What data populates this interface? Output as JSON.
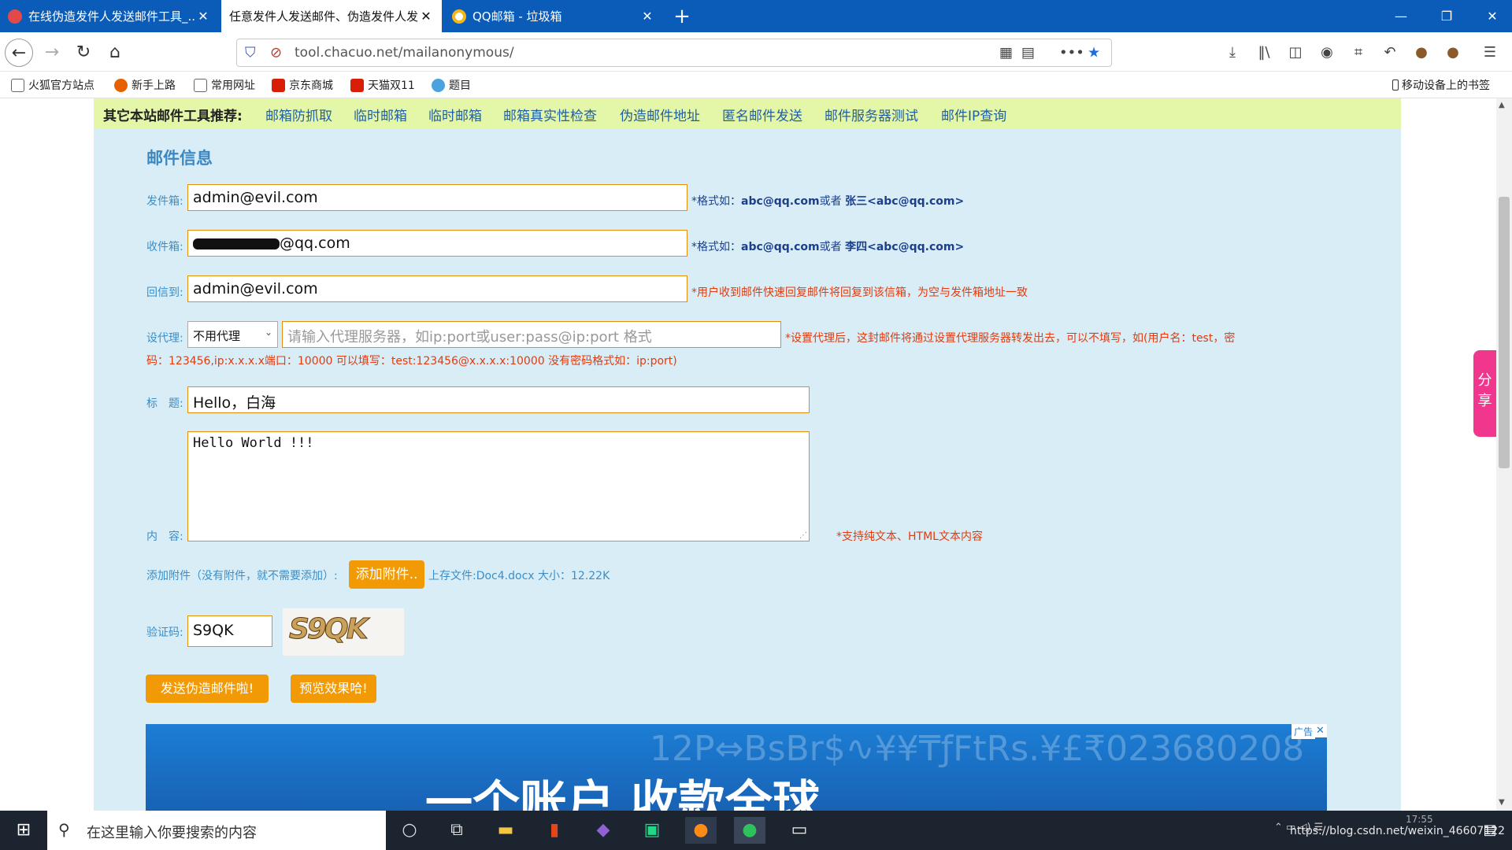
{
  "browser": {
    "tabs": [
      {
        "title": "在线伪造发件人发送邮件工具_..."
      },
      {
        "title": "任意发件人发送邮件、伪造发件人发..."
      },
      {
        "title": "QQ邮箱 - 垃圾箱"
      }
    ],
    "url": "tool.chacuo.net/mailanonymous/",
    "bookmarks": [
      "火狐官方站点",
      "新手上路",
      "常用网址",
      "京东商城",
      "天猫双11",
      "题目"
    ],
    "mobile_bookmarks": "移动设备上的书签"
  },
  "page": {
    "recommend_label": "其它本站邮件工具推荐:",
    "recommend_links": [
      "邮箱防抓取",
      "临时邮箱",
      "临时邮箱",
      "邮箱真实性检查",
      "伪造邮件地址",
      "匿名邮件发送",
      "邮件服务器测试",
      "邮件IP查询"
    ],
    "section_title": "邮件信息",
    "from": {
      "label": "发件箱:",
      "value": "admin@evil.com",
      "hint_prefix": "*格式如：",
      "hint_a": "abc@qq.com",
      "hint_mid": "或者 ",
      "hint_b": "张三<abc@qq.com>"
    },
    "to": {
      "label": "收件箱:",
      "value": "@qq.com",
      "hint_prefix": "*格式如：",
      "hint_a": "abc@qq.com",
      "hint_mid": "或者 ",
      "hint_b": "李四<abc@qq.com>"
    },
    "reply": {
      "label": "回信到:",
      "value": "admin@evil.com",
      "hint": "*用户收到邮件快速回复邮件将回复到该信箱，为空与发件箱地址一致"
    },
    "proxy": {
      "label": "设代理:",
      "select": "不用代理",
      "placeholder": "请输入代理服务器，如ip:port或user:pass@ip:port 格式",
      "hint1": "*设置代理后，这封邮件将通过设置代理服务器转发出去，可以不填写，如(用户名：test，密",
      "hint2": "码：123456,ip:x.x.x.x端口：10000 可以填写：test:123456@x.x.x.x:10000 没有密码格式如：ip:port)"
    },
    "subject": {
      "label": "标　题:",
      "value": "Hello，白海"
    },
    "content": {
      "label": "内　容:",
      "value": "Hello World !!!",
      "hint": "*支持纯文本、HTML文本内容"
    },
    "attach": {
      "label": "添加附件（没有附件，就不需要添加）:",
      "button": "添加附件..",
      "status": "上存文件:Doc4.docx 大小：12.22K"
    },
    "captcha": {
      "label": "验证码:",
      "value": "S9QK",
      "image_text": "S9QK"
    },
    "send_button": "发送伪造邮件啦!",
    "preview_button": "预览效果哈!",
    "ad": {
      "badge": "广告",
      "headline": "一个账户 收款全球",
      "bg_text": "12P⇔BsBr$∿¥¥₸ƒFtRs.¥£₹023680208"
    }
  },
  "share": "分享",
  "taskbar": {
    "search_placeholder": "在这里输入你要搜索的内容",
    "watermark": "https://blog.csdn.net/weixin_46607122",
    "clock": "17:55"
  },
  "colors": {
    "tabbar": "#0a5cb8",
    "page_bg": "#d9edf6",
    "recommend_bg": "#e4f7a8",
    "accent_orange": "#f19a06",
    "link_blue": "#1f5fa3"
  }
}
